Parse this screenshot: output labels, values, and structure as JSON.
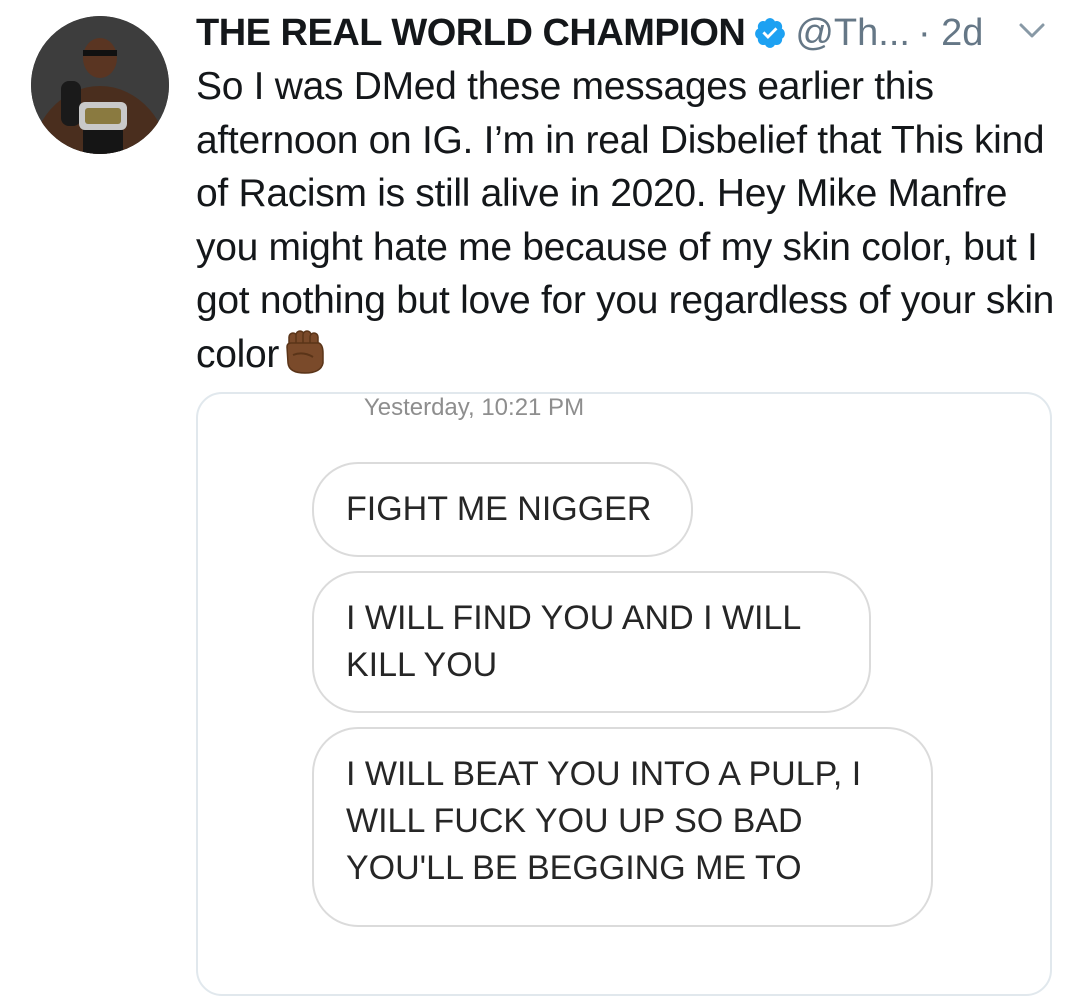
{
  "tweet": {
    "author_name": "THE REAL WORLD CHAMPION",
    "handle": "@Th...",
    "time": "· 2d",
    "body": "So I was DMed these messages earlier this afternoon on IG.  I’m in real Disbelief that This kind of Racism is still alive in 2020. Hey Mike Manfre you might hate me because of my skin color, but I got nothing but love for you regardless of your skin color",
    "emoji": "raised-fist-medium-dark-skin-tone"
  },
  "media": {
    "timestamp": "Yesterday, 10:21 PM",
    "messages": [
      "FIGHT ME NIGGER",
      "I WILL FIND YOU AND I WILL\nKILL YOU",
      "I WILL BEAT YOU INTO A PULP, I\nWILL FUCK YOU UP SO BAD\nYOU'LL BE BEGGING ME TO"
    ]
  },
  "colors": {
    "verified": "#1da1f2",
    "secondary_text": "#657786",
    "border": "#e1e8ed",
    "bubble_border": "#dbdbdb"
  },
  "icons": {
    "verified": "verified-badge-icon",
    "menu": "chevron-down-icon"
  }
}
